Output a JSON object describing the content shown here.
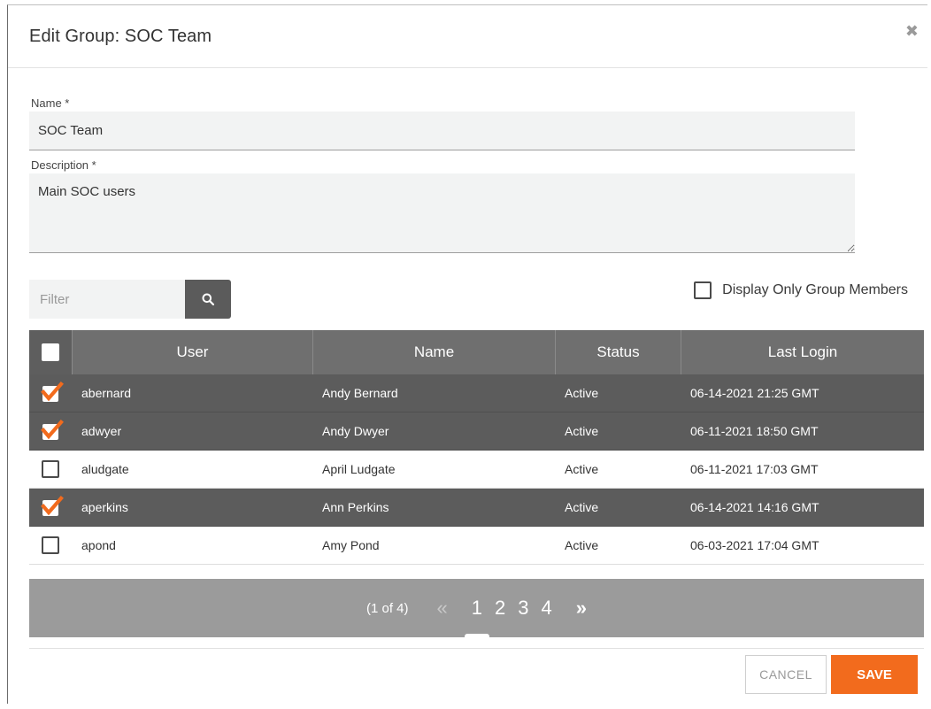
{
  "dialog": {
    "title": "Edit Group: SOC Team",
    "close_icon": "close-icon"
  },
  "form": {
    "name_label": "Name *",
    "name_value": "SOC Team",
    "description_label": "Description *",
    "description_value": "Main SOC users"
  },
  "filter": {
    "placeholder": "Filter",
    "search_icon": "search-icon"
  },
  "display_only": {
    "label": "Display Only Group Members",
    "checked": false
  },
  "table": {
    "headers": [
      "User",
      "Name",
      "Status",
      "Last Login"
    ],
    "rows": [
      {
        "user": "abernard",
        "name": "Andy Bernard",
        "status": "Active",
        "last_login": "06-14-2021 21:25 GMT",
        "selected": true
      },
      {
        "user": "adwyer",
        "name": "Andy Dwyer",
        "status": "Active",
        "last_login": "06-11-2021 18:50 GMT",
        "selected": true
      },
      {
        "user": "aludgate",
        "name": "April Ludgate",
        "status": "Active",
        "last_login": "06-11-2021 17:03 GMT",
        "selected": false
      },
      {
        "user": "aperkins",
        "name": "Ann Perkins",
        "status": "Active",
        "last_login": "06-14-2021 14:16 GMT",
        "selected": true
      },
      {
        "user": "apond",
        "name": "Amy Pond",
        "status": "Active",
        "last_login": "06-03-2021 17:04 GMT",
        "selected": false
      }
    ]
  },
  "pager": {
    "info": "(1 of 4)",
    "first_arrow": "«",
    "last_arrow": "»",
    "pages": [
      "1",
      "2",
      "3",
      "4"
    ],
    "active_page": "1"
  },
  "footer": {
    "cancel_label": "CANCEL",
    "save_label": "SAVE"
  },
  "colors": {
    "accent": "#f26b1d",
    "header_bg": "#6f6f6f",
    "selected_row_bg": "#5c5c5c",
    "pager_bg": "#9b9b9b"
  }
}
